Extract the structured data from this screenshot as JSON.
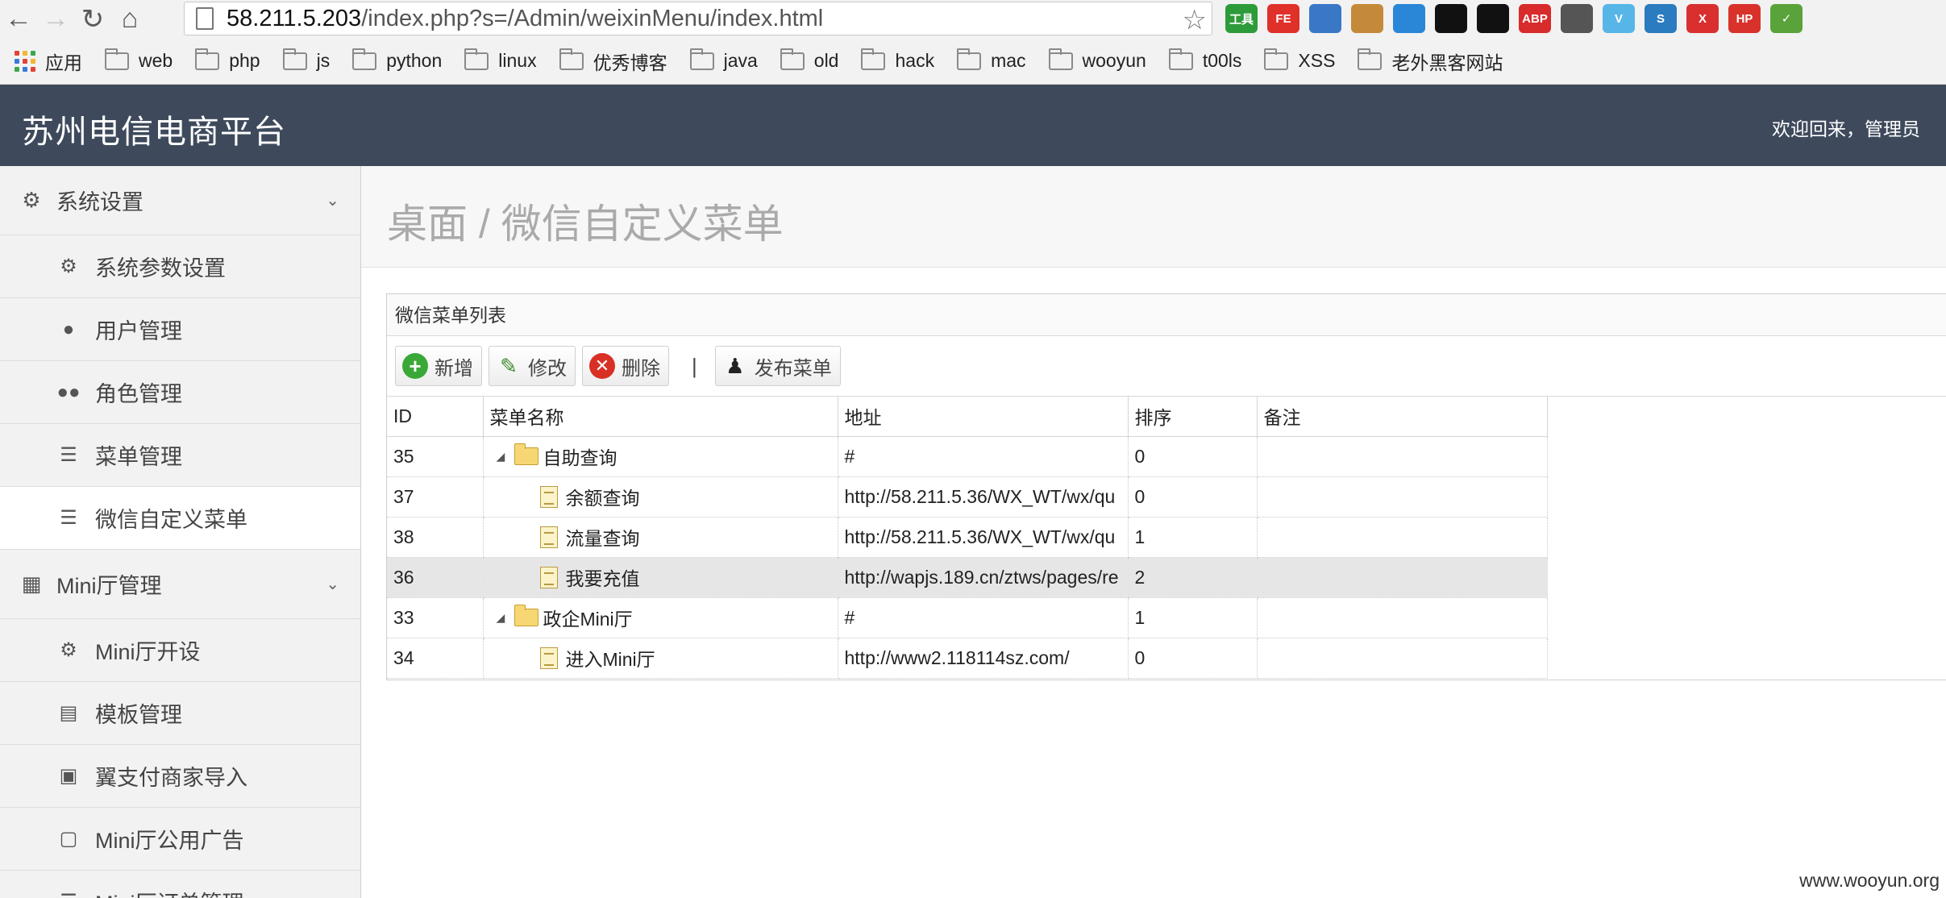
{
  "browser": {
    "url_host": "58.211.5.203",
    "url_path": "/index.php?s=/Admin/weixinMenu/index.html",
    "bookmarks": [
      "应用",
      "web",
      "php",
      "js",
      "python",
      "linux",
      "优秀博客",
      "java",
      "old",
      "hack",
      "mac",
      "wooyun",
      "t00ls",
      "XSS",
      "老外黑客网站"
    ],
    "extensions": [
      {
        "name": "tools-develop-icon",
        "label": "工具",
        "color": "#2e9b3a"
      },
      {
        "name": "fe-icon",
        "label": "FE",
        "color": "#e0302a"
      },
      {
        "name": "globe-icon",
        "label": "",
        "color": "#3a78c6"
      },
      {
        "name": "cookie-icon",
        "label": "",
        "color": "#c48a3a"
      },
      {
        "name": "cloud-icon",
        "label": "",
        "color": "#2a86d6"
      },
      {
        "name": "eye-icon",
        "label": "",
        "color": "#111111"
      },
      {
        "name": "ring-icon",
        "label": "",
        "color": "#111111"
      },
      {
        "name": "adblock-icon",
        "label": "ABP",
        "color": "#d82b2b"
      },
      {
        "name": "evernote-icon",
        "label": "",
        "color": "#555555"
      },
      {
        "name": "vimeo-icon",
        "label": "V",
        "color": "#57b5e8"
      },
      {
        "name": "s-icon",
        "label": "S",
        "color": "#2a7bbf"
      },
      {
        "name": "x-icon",
        "label": "X",
        "color": "#d92f2f"
      },
      {
        "name": "hp-icon",
        "label": "HP",
        "color": "#d8322b"
      },
      {
        "name": "check-icon",
        "label": "✓",
        "color": "#5aa33a"
      }
    ]
  },
  "header": {
    "title": "苏州电信电商平台",
    "welcome": "欢迎回来，管理员"
  },
  "sidebar": {
    "groups": [
      {
        "label": "系统设置",
        "items": [
          "系统参数设置",
          "用户管理",
          "角色管理",
          "菜单管理",
          "微信自定义菜单"
        ]
      },
      {
        "label": "Mini厅管理",
        "items": [
          "Mini厅开设",
          "模板管理",
          "翼支付商家导入",
          "Mini厅公用广告",
          "Mini厅订单管理"
        ]
      }
    ],
    "active_item": "微信自定义菜单"
  },
  "main": {
    "breadcrumb": "桌面 / 微信自定义菜单",
    "panel_title": "微信菜单列表",
    "toolbar": {
      "add": "新增",
      "edit": "修改",
      "delete": "删除",
      "separator": "|",
      "publish": "发布菜单"
    },
    "columns": [
      "ID",
      "菜单名称",
      "地址",
      "排序",
      "备注"
    ],
    "rows": [
      {
        "id": "35",
        "name": "自助查询",
        "url": "#",
        "sort": "0",
        "note": "",
        "type": "folder",
        "level": 0
      },
      {
        "id": "37",
        "name": "余额查询",
        "url": "http://58.211.5.36/WX_WT/wx/qu",
        "sort": "0",
        "note": "",
        "type": "file",
        "level": 1
      },
      {
        "id": "38",
        "name": "流量查询",
        "url": "http://58.211.5.36/WX_WT/wx/qu",
        "sort": "1",
        "note": "",
        "type": "file",
        "level": 1
      },
      {
        "id": "36",
        "name": "我要充值",
        "url": "http://wapjs.189.cn/ztws/pages/re",
        "sort": "2",
        "note": "",
        "type": "file",
        "level": 1,
        "selected": true
      },
      {
        "id": "33",
        "name": "政企Mini厅",
        "url": "#",
        "sort": "1",
        "note": "",
        "type": "folder",
        "level": 0
      },
      {
        "id": "34",
        "name": "进入Mini厅",
        "url": "http://www2.118114sz.com/",
        "sort": "0",
        "note": "",
        "type": "file",
        "level": 1
      }
    ]
  },
  "watermark": "www.wooyun.org"
}
